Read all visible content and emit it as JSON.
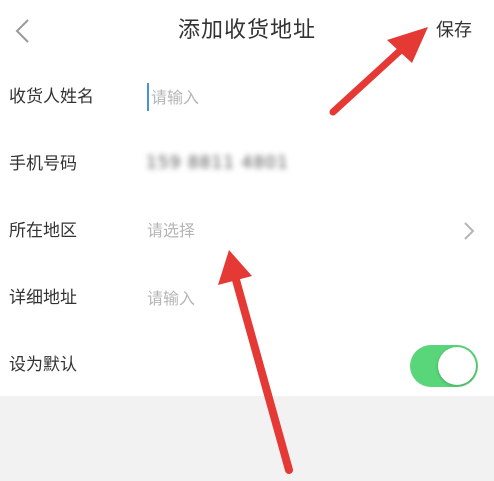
{
  "header": {
    "title": "添加收货地址",
    "save_label": "保存"
  },
  "form": {
    "name": {
      "label": "收货人姓名",
      "placeholder": "请输入"
    },
    "phone": {
      "label": "手机号码",
      "value": "159 8811 4801"
    },
    "region": {
      "label": "所在地区",
      "placeholder": "请选择"
    },
    "detail": {
      "label": "详细地址",
      "placeholder": "请输入"
    },
    "default": {
      "label": "设为默认",
      "enabled": true
    }
  },
  "colors": {
    "toggle_on": "#5ad67a",
    "annotation_arrow": "#e53935",
    "cursor": "#4a90e2"
  },
  "icons": {
    "back": "chevron-left-icon",
    "region_arrow": "chevron-right-icon"
  }
}
